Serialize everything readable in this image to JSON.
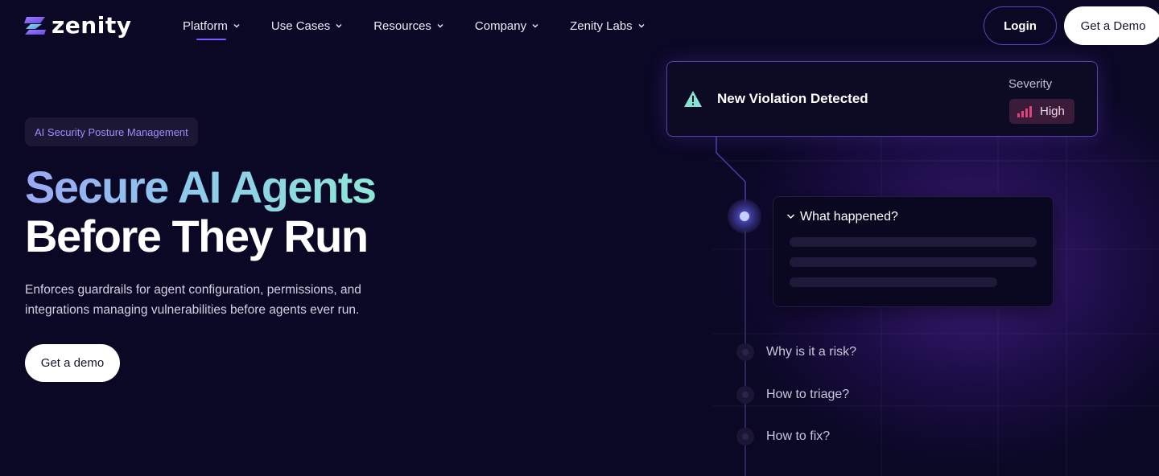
{
  "brand": {
    "name": "zenity"
  },
  "nav": {
    "items": [
      {
        "label": "Platform",
        "active": true
      },
      {
        "label": "Use Cases"
      },
      {
        "label": "Resources"
      },
      {
        "label": "Company"
      },
      {
        "label": "Zenity Labs"
      }
    ],
    "login_label": "Login",
    "demo_label": "Get a Demo"
  },
  "hero": {
    "badge": "AI Security Posture Management",
    "headline_line1": "Secure AI Agents",
    "headline_line2": "Before They Run",
    "description": "Enforces guardrails for agent configuration, permissions, and integrations managing vulnerabilities before agents ever run.",
    "cta_label": "Get a demo"
  },
  "violation": {
    "title": "New Violation Detected",
    "severity_label": "Severity",
    "severity_value": "High",
    "icon": "warning-triangle-icon"
  },
  "steps": {
    "expanded": "What happened?",
    "collapsed": [
      "Why is it a risk?",
      "How to triage?",
      "How to fix?"
    ]
  },
  "colors": {
    "background": "#0b0826",
    "accent": "#7a5cff",
    "teal": "#8de8d6",
    "severity_high": "#e0457a"
  }
}
